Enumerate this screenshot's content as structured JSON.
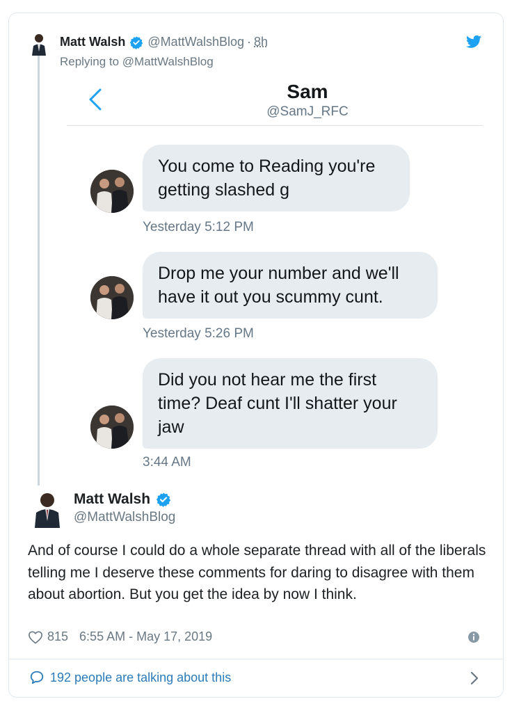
{
  "reply_tweet": {
    "author_name": "Matt Walsh",
    "author_handle": "@MattWalshBlog",
    "separator": "·",
    "time": "8h",
    "replying_to": "Replying to @MattWalshBlog"
  },
  "dm": {
    "contact_name": "Sam",
    "contact_handle": "@SamJ_RFC",
    "messages": [
      {
        "text_lines": [
          "You come to Reading you're",
          "getting slashed g"
        ],
        "time": "Yesterday 5:12 PM"
      },
      {
        "text_lines": [
          "Drop me your number and we'll",
          "have it out you scummy  cunt."
        ],
        "time": "Yesterday 5:26 PM"
      },
      {
        "text_lines": [
          "Did you not hear me the first",
          "time? Deaf cunt I'll shatter your",
          "jaw"
        ],
        "time": "3:44 AM"
      }
    ]
  },
  "main_tweet": {
    "author_name": "Matt Walsh",
    "author_handle": "@MattWalshBlog",
    "text": "And of course I could do a whole separate thread with all of the liberals telling me I deserve these comments for daring to disagree with them about abortion. But you get the idea by now I think.",
    "likes": "815",
    "timestamp": "6:55 AM - May 17, 2019"
  },
  "footer": {
    "talking_label": "192 people are talking about this"
  },
  "icons": {
    "verified": "verified-badge-icon",
    "twitter": "twitter-bird-icon",
    "back": "chevron-left-icon",
    "like": "heart-icon",
    "info": "info-icon",
    "reply": "speech-bubble-icon",
    "more": "chevron-right-icon"
  },
  "colors": {
    "twitter_blue": "#1da1f2",
    "link_blue": "#2b7bb9",
    "secondary_text": "#697882",
    "bubble_bg": "#e6ecf0"
  }
}
